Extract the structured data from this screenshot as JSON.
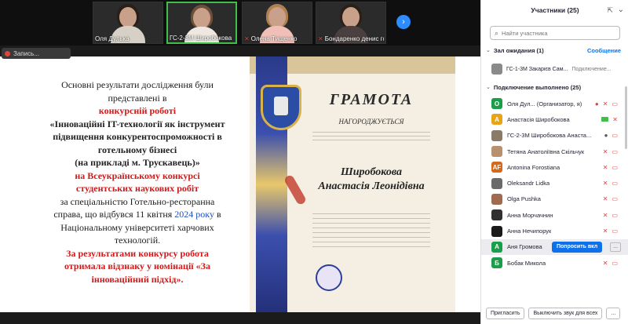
{
  "gallery": {
    "tiles": [
      {
        "name": "Оля Дулька",
        "muted": false
      },
      {
        "name": "ГС-2-3М Широбокова ...",
        "muted": false
      },
      {
        "name": "Олена Тищенко",
        "muted": true
      },
      {
        "name": "Бондаренко денис гс...",
        "muted": true
      }
    ],
    "next_icon": "chevron-right-icon"
  },
  "recording": {
    "label": "Запись..."
  },
  "slide": {
    "line1": "Основні результати дослідження були",
    "line2": "представлені в",
    "line3": "конкурсній роботі",
    "line4": "«Інноваційні IT-технології як інструмент",
    "line5": "підвищення конкурентоспроможності в",
    "line6": "готельному бізнесі",
    "line7": "(на прикладі м. Трускавець)»",
    "line8": "на Всеукраїнському конкурсі",
    "line9": "студентських наукових робіт",
    "line10": "за спеціальністю Готельно-ресторанна",
    "line11a": "справа, що відбувся 11 квітня",
    "line11_year": "2024 року",
    "line11b": "в",
    "line12": "Національному університеті харчових",
    "line13": "технологій.",
    "line14": "За результатами конкурсу робота",
    "line15": "отримала відзнаку у номінації «За",
    "line16": "інноваційний підхід»."
  },
  "certificate": {
    "title": "ГРАМОТА",
    "subtitle": "НАГОРОДЖУЄТЬСЯ",
    "name_line1": "Широбокова",
    "name_line2": "Анастасія Леонідівна"
  },
  "panel": {
    "title": "Участники (25)",
    "search_placeholder": "Найти участника",
    "waiting_section": "Зал ожидания (1)",
    "waiting_action": "Сообщение",
    "waiting_name": "ГС-1-3М Закарієв Сам...",
    "waiting_status": "Подключение...",
    "connected_section": "Подключение выполнено (25)",
    "ask_button": "Попросить вкл",
    "more_button": "...",
    "participants": [
      {
        "initial": "О",
        "color": "#1a9e4a",
        "name": "Оля Дул... (Организатор, я)",
        "icons": "rec-mic-cam"
      },
      {
        "initial": "А",
        "color": "#e8a317",
        "name": "Анастасія Широбокова",
        "icons": "cam-on"
      },
      {
        "initial": "",
        "color": "#8a7a6a",
        "name": "ГС-2-3М Широбокова Анаста...",
        "icons": "mic-on"
      },
      {
        "initial": "",
        "color": "#b89070",
        "name": "Тетяна Анатоліївна Скільчук",
        "icons": "off"
      },
      {
        "initial": "AF",
        "color": "#d2691e",
        "name": "Antonina Forostiana",
        "icons": "off"
      },
      {
        "initial": "",
        "color": "#6a6a6a",
        "name": "Oleksandr Lidka",
        "icons": "off"
      },
      {
        "initial": "",
        "color": "#a06a50",
        "name": "Olga Pushka",
        "icons": "off"
      },
      {
        "initial": "",
        "color": "#303030",
        "name": "Анна Морчачнин",
        "icons": "off"
      },
      {
        "initial": "",
        "color": "#1a1a1a",
        "name": "Анна Нечипорук",
        "icons": "off"
      },
      {
        "initial": "А",
        "color": "#1a9e4a",
        "name": "Аня Громова",
        "icons": "ask"
      },
      {
        "initial": "Б",
        "color": "#1a9e4a",
        "name": "Бобак Микола",
        "icons": "off"
      }
    ],
    "footer": {
      "invite": "Пригласить",
      "mute_all": "Выключить звук для всех",
      "more": "..."
    }
  }
}
